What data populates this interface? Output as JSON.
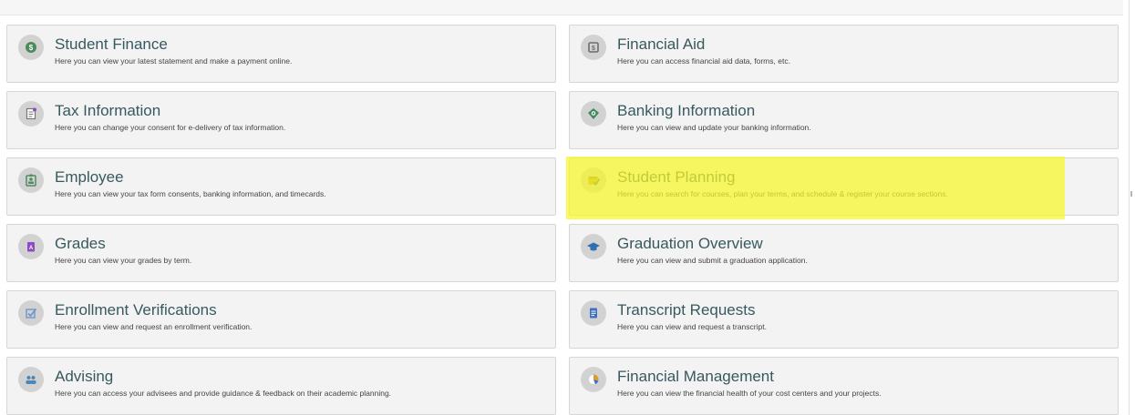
{
  "tiles": [
    {
      "title": "Student Finance",
      "desc": "Here you can view your latest statement and make a payment online.",
      "icon": "dollar-circle-icon",
      "color": "#4a8b5a"
    },
    {
      "title": "Financial Aid",
      "desc": "Here you can access financial aid data, forms, etc.",
      "icon": "cash-icon",
      "color": "#7a7a7a"
    },
    {
      "title": "Tax Information",
      "desc": "Here you can change your consent for e-delivery of tax information.",
      "icon": "tax-form-icon",
      "color": "#8a8a8a"
    },
    {
      "title": "Banking Information",
      "desc": "Here you can view and update your banking information.",
      "icon": "banking-icon",
      "color": "#3f8a5b"
    },
    {
      "title": "Employee",
      "desc": "Here you can view your tax form consents, banking information, and timecards.",
      "icon": "employee-badge-icon",
      "color": "#4f8d5f"
    },
    {
      "title": "Student Planning",
      "desc": "Here you can search for courses, plan your terms, and schedule & register your course sections.",
      "icon": "calendar-check-icon",
      "color": "#c49a28"
    },
    {
      "title": "Grades",
      "desc": "Here you can view your grades by term.",
      "icon": "grades-icon",
      "color": "#8b4cc4"
    },
    {
      "title": "Graduation Overview",
      "desc": "Here you can view and submit a graduation application.",
      "icon": "graduation-cap-icon",
      "color": "#2d6fb3"
    },
    {
      "title": "Enrollment Verifications",
      "desc": "Here you can view and request an enrollment verification.",
      "icon": "verification-check-icon",
      "color": "#6f97c7"
    },
    {
      "title": "Transcript Requests",
      "desc": "Here you can view and request a transcript.",
      "icon": "transcript-icon",
      "color": "#3f6fc0"
    },
    {
      "title": "Advising",
      "desc": "Here you can access your advisees and provide guidance & feedback on their academic planning.",
      "icon": "advising-people-icon",
      "color": "#4a86b8"
    },
    {
      "title": "Financial Management",
      "desc": "Here you can view the financial health of your cost centers and your projects.",
      "icon": "pie-chart-icon",
      "color": "#e09a2a"
    }
  ],
  "highlighted_tile": "Student Planning"
}
